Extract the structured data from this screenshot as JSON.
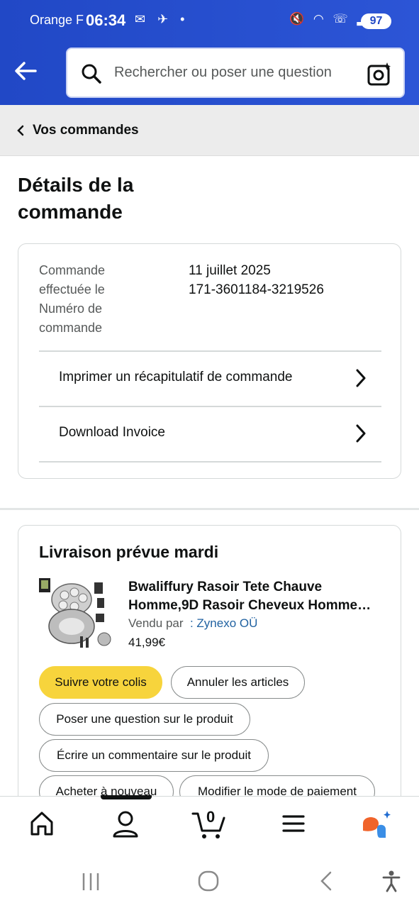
{
  "status_bar": {
    "carrier": "Orange F",
    "time": "06:34",
    "battery": "97",
    "left_icons": "outlook-icon, signal-boost-icon, dot",
    "right_icons": "mute-icon, wifi-call-icon, signal-icon"
  },
  "header": {
    "search_placeholder": "Rechercher ou poser une question"
  },
  "breadcrumb": {
    "label": "Vos commandes"
  },
  "page": {
    "title": "Détails de la commande"
  },
  "order_info": {
    "labels": [
      "Commande effectuée le",
      "Numéro de commande"
    ],
    "label_1": "Commande",
    "label_2": "effectuée le",
    "label_3": "Numéro de",
    "label_4": "commande",
    "date": "11 juillet 2025",
    "number": "171-3601184-3219526",
    "links": {
      "print_summary": "Imprimer un récapitulatif de commande",
      "download_invoice": "Download Invoice"
    }
  },
  "delivery": {
    "heading": "Livraison prévue mardi",
    "product": {
      "name_line1": "Bwaliffury Rasoir Tete Chauve",
      "name_line2": "Homme,9D Rasoir Cheveux Homme…",
      "seller_prefix": "Vendu par",
      "seller_name": ": Zynexo OÜ",
      "price": "41,99€"
    },
    "buttons": {
      "track": "Suivre votre colis",
      "cancel": "Annuler les articles",
      "question": "Poser une question sur le produit",
      "review": "Écrire un commentaire sur le produit",
      "buy_again": "Acheter à nouveau",
      "payment": "Modifier le mode de paiement"
    }
  },
  "bottom_nav": {
    "cart_count": "0"
  },
  "colors": {
    "header_blue": "#2148c6",
    "primary_button": "#f7d43c",
    "link_blue": "#2162a1"
  }
}
